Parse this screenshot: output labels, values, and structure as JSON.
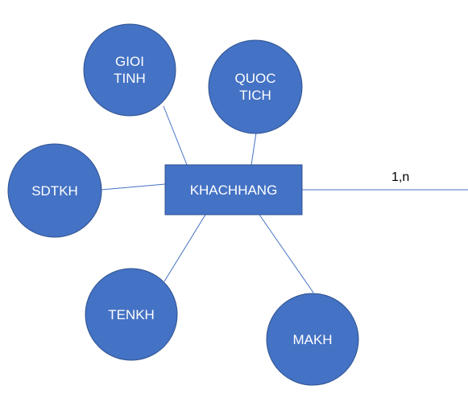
{
  "entity": {
    "name": "KHACHHANG"
  },
  "attributes": {
    "gioitinh": {
      "line1": "GIOI",
      "line2": "TINH"
    },
    "quoctich": {
      "line1": "QUOC",
      "line2": "TICH"
    },
    "sdtkh": {
      "label": "SDTKH"
    },
    "tenkh": {
      "label": "TENKH"
    },
    "makh": {
      "label": "MAKH"
    }
  },
  "relationship": {
    "cardinality": "1,n"
  },
  "colors": {
    "fill": "#4472C4",
    "outline": "#2F528F",
    "line": "#4472C4",
    "text_on_shape": "#FFFFFF",
    "label_text": "#000000"
  }
}
